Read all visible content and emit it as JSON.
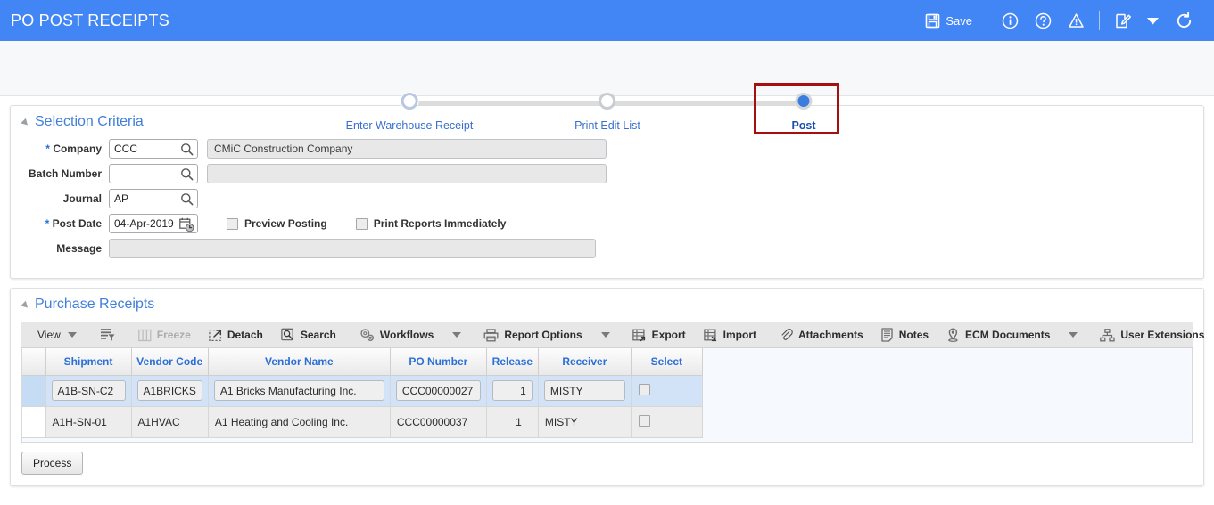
{
  "header": {
    "title": "PO POST RECEIPTS",
    "save_label": "Save",
    "icons": {
      "save": "floppy-disk-icon",
      "info": "info-circle-icon",
      "help": "help-circle-icon",
      "warning": "warning-triangle-icon",
      "notes": "edit-note-icon",
      "notes_caret": "chevron-down-icon",
      "refresh": "refresh-icon"
    },
    "background_color": "#4285f4"
  },
  "train": {
    "steps": [
      {
        "label": "Enter Warehouse Receipt",
        "state": "visited"
      },
      {
        "label": "Print Edit List",
        "state": "pending"
      },
      {
        "label": "Post",
        "state": "current"
      }
    ],
    "highlight_color": "#a50f0f",
    "current_dot_color": "#3b7ddd"
  },
  "selection_criteria": {
    "title": "Selection Criteria",
    "fields": {
      "company": {
        "label": "Company",
        "required": true,
        "value": "CCC",
        "description": "CMiC Construction Company"
      },
      "batch_number": {
        "label": "Batch Number",
        "required": false,
        "value": "",
        "description": ""
      },
      "journal": {
        "label": "Journal",
        "required": false,
        "value": "AP"
      },
      "post_date": {
        "label": "Post Date",
        "required": true,
        "value": "04-Apr-2019"
      },
      "message": {
        "label": "Message",
        "value": ""
      }
    },
    "checkboxes": [
      {
        "label": "Preview Posting",
        "checked": false
      },
      {
        "label": "Print Reports Immediately",
        "checked": false
      }
    ]
  },
  "purchase_receipts": {
    "title": "Purchase Receipts",
    "toolbar": [
      {
        "label": "View",
        "icon": "chevron-down-icon",
        "disabled": false,
        "has_caret": true
      },
      {
        "label": "",
        "icon": "query-filter-icon",
        "disabled": false,
        "has_caret": false
      },
      {
        "label": "Freeze",
        "icon": "freeze-columns-icon",
        "disabled": true,
        "has_caret": false
      },
      {
        "label": "Detach",
        "icon": "detach-icon",
        "disabled": false,
        "has_caret": false
      },
      {
        "label": "Search",
        "icon": "search-icon",
        "disabled": false,
        "has_caret": false
      },
      {
        "label": "Workflows",
        "icon": "gears-icon",
        "disabled": false,
        "has_caret": true
      },
      {
        "label": "Report Options",
        "icon": "printer-icon",
        "disabled": false,
        "has_caret": true
      },
      {
        "label": "Export",
        "icon": "export-grid-icon",
        "disabled": false,
        "has_caret": false
      },
      {
        "label": "Import",
        "icon": "import-grid-icon",
        "disabled": false,
        "has_caret": false
      },
      {
        "label": "Attachments",
        "icon": "paperclip-icon",
        "disabled": false,
        "has_caret": false
      },
      {
        "label": "Notes",
        "icon": "notes-page-icon",
        "disabled": false,
        "has_caret": false
      },
      {
        "label": "ECM Documents",
        "icon": "ecm-document-icon",
        "disabled": false,
        "has_caret": true
      },
      {
        "label": "User Extensions",
        "icon": "hierarchy-icon",
        "disabled": false,
        "has_caret": false
      }
    ],
    "columns": [
      "Shipment",
      "Vendor Code",
      "Vendor Name",
      "PO Number",
      "Release",
      "Receiver",
      "Select"
    ],
    "rows": [
      {
        "selected": true,
        "shipment": "A1B-SN-C2",
        "vendor_code": "A1BRICKS",
        "vendor_name": "A1 Bricks Manufacturing Inc.",
        "po_number": "CCC00000027",
        "release": "1",
        "receiver": "MISTY",
        "select": false
      },
      {
        "selected": false,
        "shipment": "A1H-SN-01",
        "vendor_code": "A1HVAC",
        "vendor_name": "A1 Heating and Cooling Inc.",
        "po_number": "CCC00000037",
        "release": "1",
        "receiver": "MISTY",
        "select": false
      }
    ],
    "process_label": "Process"
  }
}
